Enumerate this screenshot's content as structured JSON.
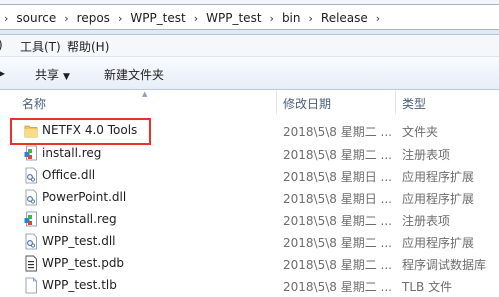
{
  "address_bar": {
    "crumbs": [
      "source",
      "repos",
      "WPP_test",
      "WPP_test",
      "bin",
      "Release"
    ],
    "separator": "›"
  },
  "menu": {
    "tools": "工具(T)",
    "help": "帮助(H)"
  },
  "toolbar": {
    "share": "共享",
    "new_folder": "新建文件夹"
  },
  "columns": {
    "name": "名称",
    "modified": "修改日期",
    "type": "类型"
  },
  "files": [
    {
      "name": "NETFX 4.0 Tools",
      "modified": "2018\\5\\8 星期二 ...",
      "type": "文件夹",
      "icon": "folder-icon"
    },
    {
      "name": "install.reg",
      "modified": "2018\\5\\8 星期二 ...",
      "type": "注册表项",
      "icon": "reg-file-icon"
    },
    {
      "name": "Office.dll",
      "modified": "2018\\5\\8 星期日 ...",
      "type": "应用程序扩展",
      "icon": "dll-file-icon"
    },
    {
      "name": "PowerPoint.dll",
      "modified": "2018\\5\\8 星期日 ...",
      "type": "应用程序扩展",
      "icon": "dll-file-icon"
    },
    {
      "name": "uninstall.reg",
      "modified": "2018\\5\\8 星期二 ...",
      "type": "注册表项",
      "icon": "reg-file-icon"
    },
    {
      "name": "WPP_test.dll",
      "modified": "2018\\5\\8 星期二 ...",
      "type": "应用程序扩展",
      "icon": "dll-file-icon"
    },
    {
      "name": "WPP_test.pdb",
      "modified": "2018\\5\\8 星期二 ...",
      "type": "程序调试数据库",
      "icon": "pdb-file-icon"
    },
    {
      "name": "WPP_test.tlb",
      "modified": "2018\\5\\8 星期二 ...",
      "type": "TLB 文件",
      "icon": "tlb-file-icon"
    }
  ],
  "colors": {
    "highlight_border": "#e8322a"
  }
}
